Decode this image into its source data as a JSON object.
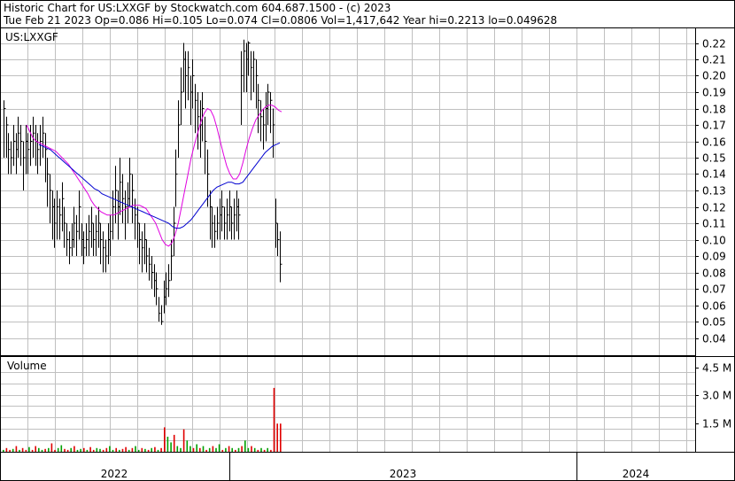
{
  "header": {
    "line1": "Historic Chart for US:LXXGF by Stockwatch.com 604.687.1500 - (c) 2023",
    "line2": "Tue Feb 21 2023  Op=0.086  Hi=0.105  Lo=0.074  Cl=0.0806  Vol=1,417,642  Year hi=0.2213  lo=0.049628"
  },
  "price_panel": {
    "label": "US:LXXGF"
  },
  "volume_panel": {
    "label": "Volume"
  },
  "colors": {
    "grid": "#c0c0c0",
    "price_bar": "#000000",
    "ma_short": "#e000e0",
    "ma_long": "#0000d0",
    "vol_up": "#00a000",
    "vol_down": "#e00000"
  },
  "chart_data": [
    {
      "type": "line",
      "title": "Historic Chart for US:LXXGF",
      "y_ticks": [
        0.04,
        0.05,
        0.06,
        0.07,
        0.08,
        0.09,
        0.1,
        0.11,
        0.12,
        0.13,
        0.14,
        0.15,
        0.16,
        0.17,
        0.18,
        0.19,
        0.2,
        0.21,
        0.22
      ],
      "y_tick_labels": [
        "0.04",
        "0.05",
        "0.06",
        "0.07",
        "0.08",
        "0.09",
        "0.10",
        "0.11",
        "0.12",
        "0.13",
        "0.14",
        "0.15",
        "0.16",
        "0.17",
        "0.18",
        "0.19",
        "0.20",
        "0.21",
        "0.22"
      ],
      "x_labels": [
        "2022",
        "2023",
        "2024"
      ],
      "ylim": [
        0.03,
        0.225
      ],
      "grid": true,
      "series": [
        {
          "kind": "price",
          "values": [
            0.18,
            0.17,
            0.155,
            0.15,
            0.16,
            0.155,
            0.165,
            0.16,
            0.15,
            0.16,
            0.155,
            0.16,
            0.165,
            0.16,
            0.155,
            0.16,
            0.165,
            0.155,
            0.14,
            0.13,
            0.12,
            0.11,
            0.12,
            0.115,
            0.125,
            0.11,
            0.1,
            0.095,
            0.1,
            0.11,
            0.105,
            0.12,
            0.1,
            0.095,
            0.1,
            0.105,
            0.11,
            0.1,
            0.105,
            0.11,
            0.1,
            0.095,
            0.09,
            0.1,
            0.105,
            0.12,
            0.13,
            0.12,
            0.135,
            0.125,
            0.12,
            0.125,
            0.14,
            0.13,
            0.115,
            0.11,
            0.1,
            0.095,
            0.1,
            0.09,
            0.085,
            0.08,
            0.075,
            0.07,
            0.055,
            0.05,
            0.065,
            0.07,
            0.075,
            0.09,
            0.11,
            0.14,
            0.17,
            0.19,
            0.21,
            0.2,
            0.205,
            0.19,
            0.2,
            0.185,
            0.175,
            0.17,
            0.18,
            0.16,
            0.14,
            0.12,
            0.11,
            0.105,
            0.11,
            0.115,
            0.12,
            0.11,
            0.115,
            0.12,
            0.11,
            0.115,
            0.12,
            0.115,
            0.2,
            0.215,
            0.21,
            0.22,
            0.205,
            0.21,
            0.2,
            0.185,
            0.175,
            0.17,
            0.18,
            0.19,
            0.185,
            0.17,
            0.11,
            0.1,
            0.085
          ],
          "lows": [
            0.15,
            0.15,
            0.14,
            0.14,
            0.145,
            0.14,
            0.15,
            0.145,
            0.13,
            0.14,
            0.14,
            0.145,
            0.15,
            0.145,
            0.14,
            0.145,
            0.15,
            0.135,
            0.12,
            0.11,
            0.1,
            0.095,
            0.1,
            0.1,
            0.105,
            0.095,
            0.09,
            0.085,
            0.09,
            0.095,
            0.09,
            0.1,
            0.09,
            0.085,
            0.09,
            0.09,
            0.095,
            0.09,
            0.09,
            0.095,
            0.085,
            0.08,
            0.08,
            0.085,
            0.09,
            0.1,
            0.11,
            0.1,
            0.115,
            0.11,
            0.1,
            0.11,
            0.12,
            0.11,
            0.1,
            0.095,
            0.085,
            0.08,
            0.085,
            0.08,
            0.075,
            0.07,
            0.065,
            0.06,
            0.05,
            0.048,
            0.055,
            0.06,
            0.065,
            0.075,
            0.09,
            0.12,
            0.15,
            0.17,
            0.19,
            0.18,
            0.185,
            0.17,
            0.18,
            0.165,
            0.155,
            0.15,
            0.16,
            0.14,
            0.12,
            0.1,
            0.095,
            0.095,
            0.1,
            0.1,
            0.105,
            0.1,
            0.1,
            0.105,
            0.1,
            0.1,
            0.105,
            0.1,
            0.17,
            0.19,
            0.19,
            0.2,
            0.185,
            0.19,
            0.18,
            0.165,
            0.16,
            0.155,
            0.16,
            0.17,
            0.165,
            0.15,
            0.095,
            0.09,
            0.074
          ],
          "highs": [
            0.185,
            0.175,
            0.165,
            0.16,
            0.17,
            0.165,
            0.175,
            0.17,
            0.16,
            0.17,
            0.165,
            0.17,
            0.175,
            0.17,
            0.165,
            0.17,
            0.175,
            0.165,
            0.15,
            0.14,
            0.13,
            0.125,
            0.13,
            0.125,
            0.135,
            0.12,
            0.11,
            0.105,
            0.11,
            0.12,
            0.115,
            0.13,
            0.11,
            0.105,
            0.11,
            0.115,
            0.12,
            0.11,
            0.115,
            0.12,
            0.11,
            0.105,
            0.1,
            0.11,
            0.115,
            0.13,
            0.145,
            0.13,
            0.15,
            0.14,
            0.13,
            0.135,
            0.15,
            0.14,
            0.125,
            0.12,
            0.11,
            0.105,
            0.11,
            0.1,
            0.095,
            0.09,
            0.085,
            0.08,
            0.065,
            0.06,
            0.075,
            0.08,
            0.085,
            0.1,
            0.12,
            0.155,
            0.185,
            0.205,
            0.22,
            0.215,
            0.215,
            0.2,
            0.21,
            0.195,
            0.19,
            0.185,
            0.19,
            0.175,
            0.155,
            0.13,
            0.12,
            0.115,
            0.12,
            0.125,
            0.13,
            0.12,
            0.125,
            0.13,
            0.12,
            0.125,
            0.13,
            0.125,
            0.215,
            0.222,
            0.22,
            0.221,
            0.215,
            0.215,
            0.21,
            0.195,
            0.185,
            0.18,
            0.19,
            0.195,
            0.19,
            0.18,
            0.125,
            0.11,
            0.105
          ]
        },
        {
          "kind": "ma_short",
          "values": [
            0.17,
            0.166,
            0.162,
            0.16,
            0.159,
            0.158,
            0.157,
            0.156,
            0.155,
            0.154,
            0.152,
            0.15,
            0.148,
            0.146,
            0.143,
            0.14,
            0.137,
            0.134,
            0.131,
            0.128,
            0.124,
            0.121,
            0.119,
            0.117,
            0.116,
            0.115,
            0.115,
            0.115,
            0.116,
            0.117,
            0.118,
            0.119,
            0.12,
            0.121,
            0.121,
            0.121,
            0.12,
            0.119,
            0.116,
            0.113,
            0.11,
            0.105,
            0.1,
            0.097,
            0.096,
            0.098,
            0.103,
            0.11,
            0.12,
            0.13,
            0.14,
            0.15,
            0.158,
            0.165,
            0.172,
            0.177,
            0.18,
            0.179,
            0.175,
            0.168,
            0.16,
            0.152,
            0.145,
            0.14,
            0.137,
            0.137,
            0.14,
            0.147,
            0.155,
            0.162,
            0.168,
            0.173,
            0.176,
            0.179,
            0.181,
            0.182,
            0.182,
            0.181,
            0.179,
            0.178
          ]
        },
        {
          "kind": "ma_long",
          "values": [
            0.158,
            0.157,
            0.156,
            0.155,
            0.153,
            0.151,
            0.149,
            0.147,
            0.145,
            0.143,
            0.141,
            0.139,
            0.137,
            0.135,
            0.133,
            0.131,
            0.13,
            0.128,
            0.127,
            0.126,
            0.125,
            0.124,
            0.123,
            0.122,
            0.121,
            0.12,
            0.119,
            0.118,
            0.117,
            0.116,
            0.115,
            0.114,
            0.113,
            0.112,
            0.111,
            0.11,
            0.108,
            0.107,
            0.107,
            0.108,
            0.11,
            0.112,
            0.115,
            0.118,
            0.121,
            0.124,
            0.127,
            0.13,
            0.132,
            0.133,
            0.134,
            0.135,
            0.135,
            0.134,
            0.134,
            0.135,
            0.138,
            0.141,
            0.144,
            0.147,
            0.15,
            0.153,
            0.155,
            0.157,
            0.158,
            0.159
          ]
        }
      ]
    },
    {
      "type": "bar",
      "title": "Volume",
      "y_ticks": [
        1.5,
        3.0,
        4.5
      ],
      "y_tick_labels": [
        "1.5 M",
        "3.0 M",
        "4.5 M"
      ],
      "ylim": [
        0,
        5.5
      ],
      "values": [
        0.1,
        0.2,
        0.1,
        0.15,
        0.3,
        0.1,
        0.2,
        0.1,
        0.25,
        0.1,
        0.3,
        0.2,
        0.1,
        0.15,
        0.2,
        0.45,
        0.1,
        0.2,
        0.35,
        0.15,
        0.1,
        0.2,
        0.3,
        0.1,
        0.15,
        0.2,
        0.1,
        0.25,
        0.1,
        0.2,
        0.15,
        0.1,
        0.2,
        0.3,
        0.1,
        0.2,
        0.1,
        0.15,
        0.25,
        0.1,
        0.2,
        0.3,
        0.1,
        0.2,
        0.15,
        0.1,
        0.2,
        0.25,
        0.1,
        0.2,
        1.3,
        0.8,
        0.5,
        0.9,
        0.3,
        0.2,
        1.2,
        0.6,
        0.3,
        0.2,
        0.4,
        0.2,
        0.3,
        0.1,
        0.2,
        0.3,
        0.2,
        0.4,
        0.1,
        0.2,
        0.3,
        0.2,
        0.1,
        0.2,
        0.3,
        0.6,
        0.2,
        0.3,
        0.2,
        0.1,
        0.2,
        0.1,
        0.2,
        0.1,
        3.4,
        1.5,
        1.5
      ],
      "directions": [
        "u",
        "d",
        "d",
        "u",
        "d",
        "u",
        "d",
        "d",
        "u",
        "d",
        "d",
        "u",
        "u",
        "d",
        "u",
        "d",
        "d",
        "u",
        "u",
        "d",
        "d",
        "u",
        "d",
        "u",
        "u",
        "d",
        "u",
        "d",
        "d",
        "u",
        "u",
        "d",
        "d",
        "u",
        "u",
        "d",
        "u",
        "d",
        "d",
        "u",
        "d",
        "u",
        "u",
        "d",
        "u",
        "d",
        "u",
        "d",
        "u",
        "d",
        "d",
        "u",
        "u",
        "d",
        "u",
        "u",
        "d",
        "u",
        "u",
        "d",
        "u",
        "d",
        "u",
        "d",
        "u",
        "d",
        "u",
        "u",
        "d",
        "u",
        "d",
        "u",
        "d",
        "u",
        "d",
        "u",
        "u",
        "d",
        "u",
        "d",
        "u",
        "d",
        "u",
        "d",
        "d",
        "d",
        "d"
      ]
    }
  ]
}
